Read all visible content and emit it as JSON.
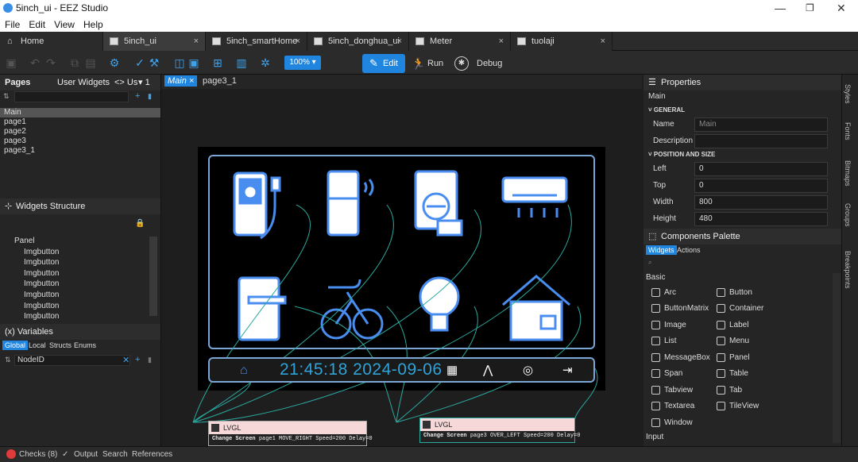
{
  "window": {
    "title": "5inch_ui - EEZ Studio"
  },
  "menu": [
    "File",
    "Edit",
    "View",
    "Help"
  ],
  "tabs": [
    {
      "label": "Home"
    },
    {
      "label": "5inch_ui"
    },
    {
      "label": "5inch_smartHome"
    },
    {
      "label": "5inch_donghua_ui"
    },
    {
      "label": "Meter"
    },
    {
      "label": "tuolaji"
    }
  ],
  "toolbar": {
    "zoom": "100% ▾",
    "edit": "Edit",
    "run": "Run",
    "debug": "Debug"
  },
  "pages_panel": {
    "tabs": [
      "Pages",
      "User Widgets",
      "<> Us",
      "▾ 1"
    ],
    "items": [
      "Main",
      "page1",
      "page2",
      "page3",
      "page3_1"
    ],
    "selected": "Main"
  },
  "widgets_structure": {
    "title": "Widgets Structure",
    "items": [
      "Panel",
      "Imgbutton",
      "Imgbutton",
      "Imgbutton",
      "Imgbutton",
      "Imgbutton",
      "Imgbutton",
      "Imgbutton"
    ]
  },
  "variables": {
    "title": "(x) Variables",
    "tabs": [
      "Global",
      "Local",
      "Structs",
      "Enums"
    ],
    "items": [
      "NodeID"
    ]
  },
  "canvas_tabs": [
    "Main",
    "page3_1"
  ],
  "canvas": {
    "clock": "21:45:18 2024-09-06",
    "nodes": [
      {
        "title": "LVGL",
        "action": "Change Screen",
        "body": "page1 MOVE_RIGHT Speed=200 Delay=0"
      },
      {
        "title": "LVGL",
        "action": "Change Screen",
        "body": "page3 OVER_LEFT Speed=200 Delay=0"
      }
    ]
  },
  "properties": {
    "title": "Properties",
    "subtitle": "Main",
    "general_label": "GENERAL",
    "name_label": "Name",
    "name_value": "Main",
    "description_label": "Description",
    "description_value": "",
    "position_label": "POSITION AND SIZE",
    "left_label": "Left",
    "left_value": "0",
    "top_label": "Top",
    "top_value": "0",
    "width_label": "Width",
    "width_value": "800",
    "height_label": "Height",
    "height_value": "480"
  },
  "palette": {
    "title": "Components Palette",
    "tabs": [
      "Widgets",
      "Actions"
    ],
    "section_basic": "Basic",
    "section_input": "Input",
    "components": [
      "Arc",
      "Button",
      "ButtonMatrix",
      "Container",
      "Image",
      "Label",
      "List",
      "Menu",
      "MessageBox",
      "Panel",
      "Span",
      "Table",
      "Tabview",
      "Tab",
      "Textarea",
      "TileView",
      "Window"
    ]
  },
  "side_tabs": [
    "Styles",
    "Fonts",
    "Bitmaps",
    "Groups",
    "Breakpoints"
  ],
  "status": {
    "checks": "Checks (8)",
    "output": "Output",
    "search": "Search",
    "references": "References"
  },
  "colors": {
    "accent": "#1f85de",
    "canvas_cyan": "#2ea3d8",
    "frame": "#7aa6d6"
  }
}
